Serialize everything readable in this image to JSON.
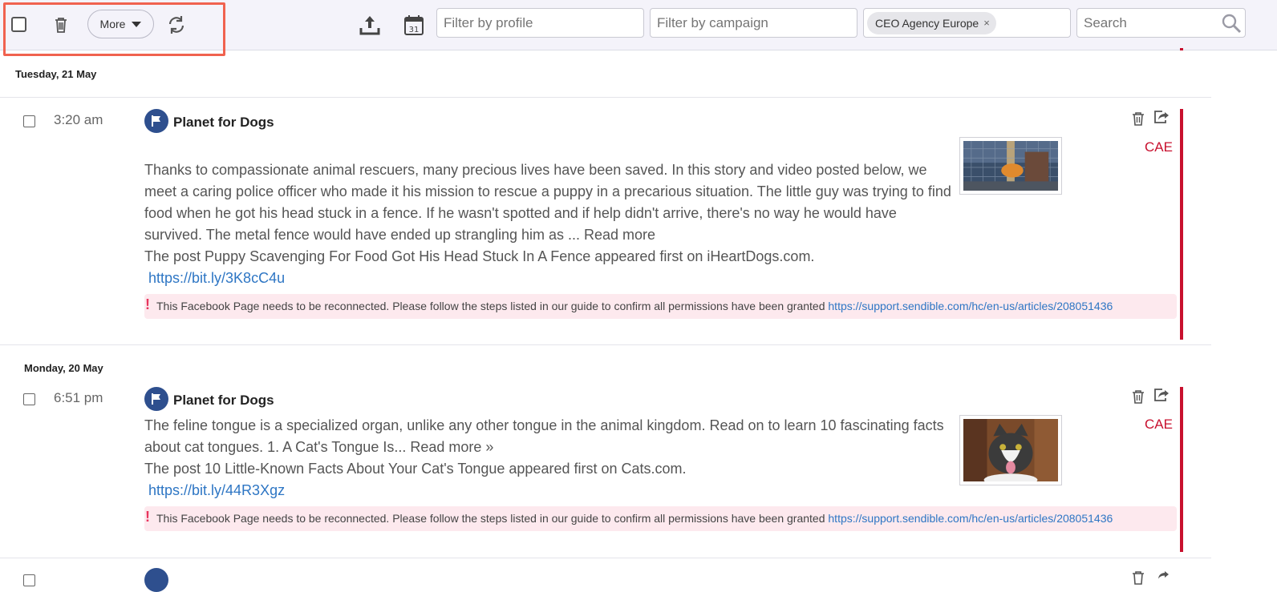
{
  "toolbar": {
    "more_label": "More",
    "filter_profile_placeholder": "Filter by profile",
    "filter_campaign_placeholder": "Filter by campaign",
    "tag": "CEO Agency Europe",
    "tag_remove": "×",
    "search_placeholder": "Search"
  },
  "posts": [
    {
      "date": "Tuesday, 21 May",
      "time": "3:20 am",
      "profile": "Planet for Dogs",
      "body": "Thanks to compassionate animal rescuers, many precious lives have been saved. In this story and video posted below, we meet a caring police officer who made it his mission to rescue a puppy in a precarious situation. The little guy was trying to find food when he got his head stuck in a fence. If he wasn't spotted and if help didn't arrive, there's no way he would have survived. The metal fence would have ended up strangling him as ... ",
      "read_more": "Read more",
      "appeared": "The post Puppy Scavenging For Food Got His Head Stuck In A Fence appeared first on iHeartDogs.com.",
      "link": "https://bit.ly/3K8cC4u",
      "warning": "This Facebook Page needs to be reconnected. Please follow the steps listed in our guide to confirm all permissions have been granted ",
      "warning_link": "https://support.sendible.com/hc/en-us/articles/208051436",
      "campaign": "CAE"
    },
    {
      "date": "Monday, 20 May",
      "time": "6:51 pm",
      "profile": "Planet for Dogs",
      "body": "The feline tongue is a specialized organ, unlike any other tongue in the animal kingdom. Read on to learn 10 fascinating facts about cat tongues. 1. A Cat's Tongue Is... ",
      "read_more": "Read more »",
      "appeared": "The post 10 Little-Known Facts About Your Cat's Tongue appeared first on Cats.com.",
      "link": "https://bit.ly/44R3Xgz",
      "warning": "This Facebook Page needs to be reconnected. Please follow the steps listed in our guide to confirm all permissions have been granted ",
      "warning_link": "https://support.sendible.com/hc/en-us/articles/208051436",
      "campaign": "CAE"
    }
  ],
  "colors": {
    "accent_red": "#c8102e",
    "link_blue": "#2e76c4",
    "warning_bg": "#fde9ee",
    "toolbar_bg": "#f4f3fa",
    "highlight": "#f0624f"
  }
}
